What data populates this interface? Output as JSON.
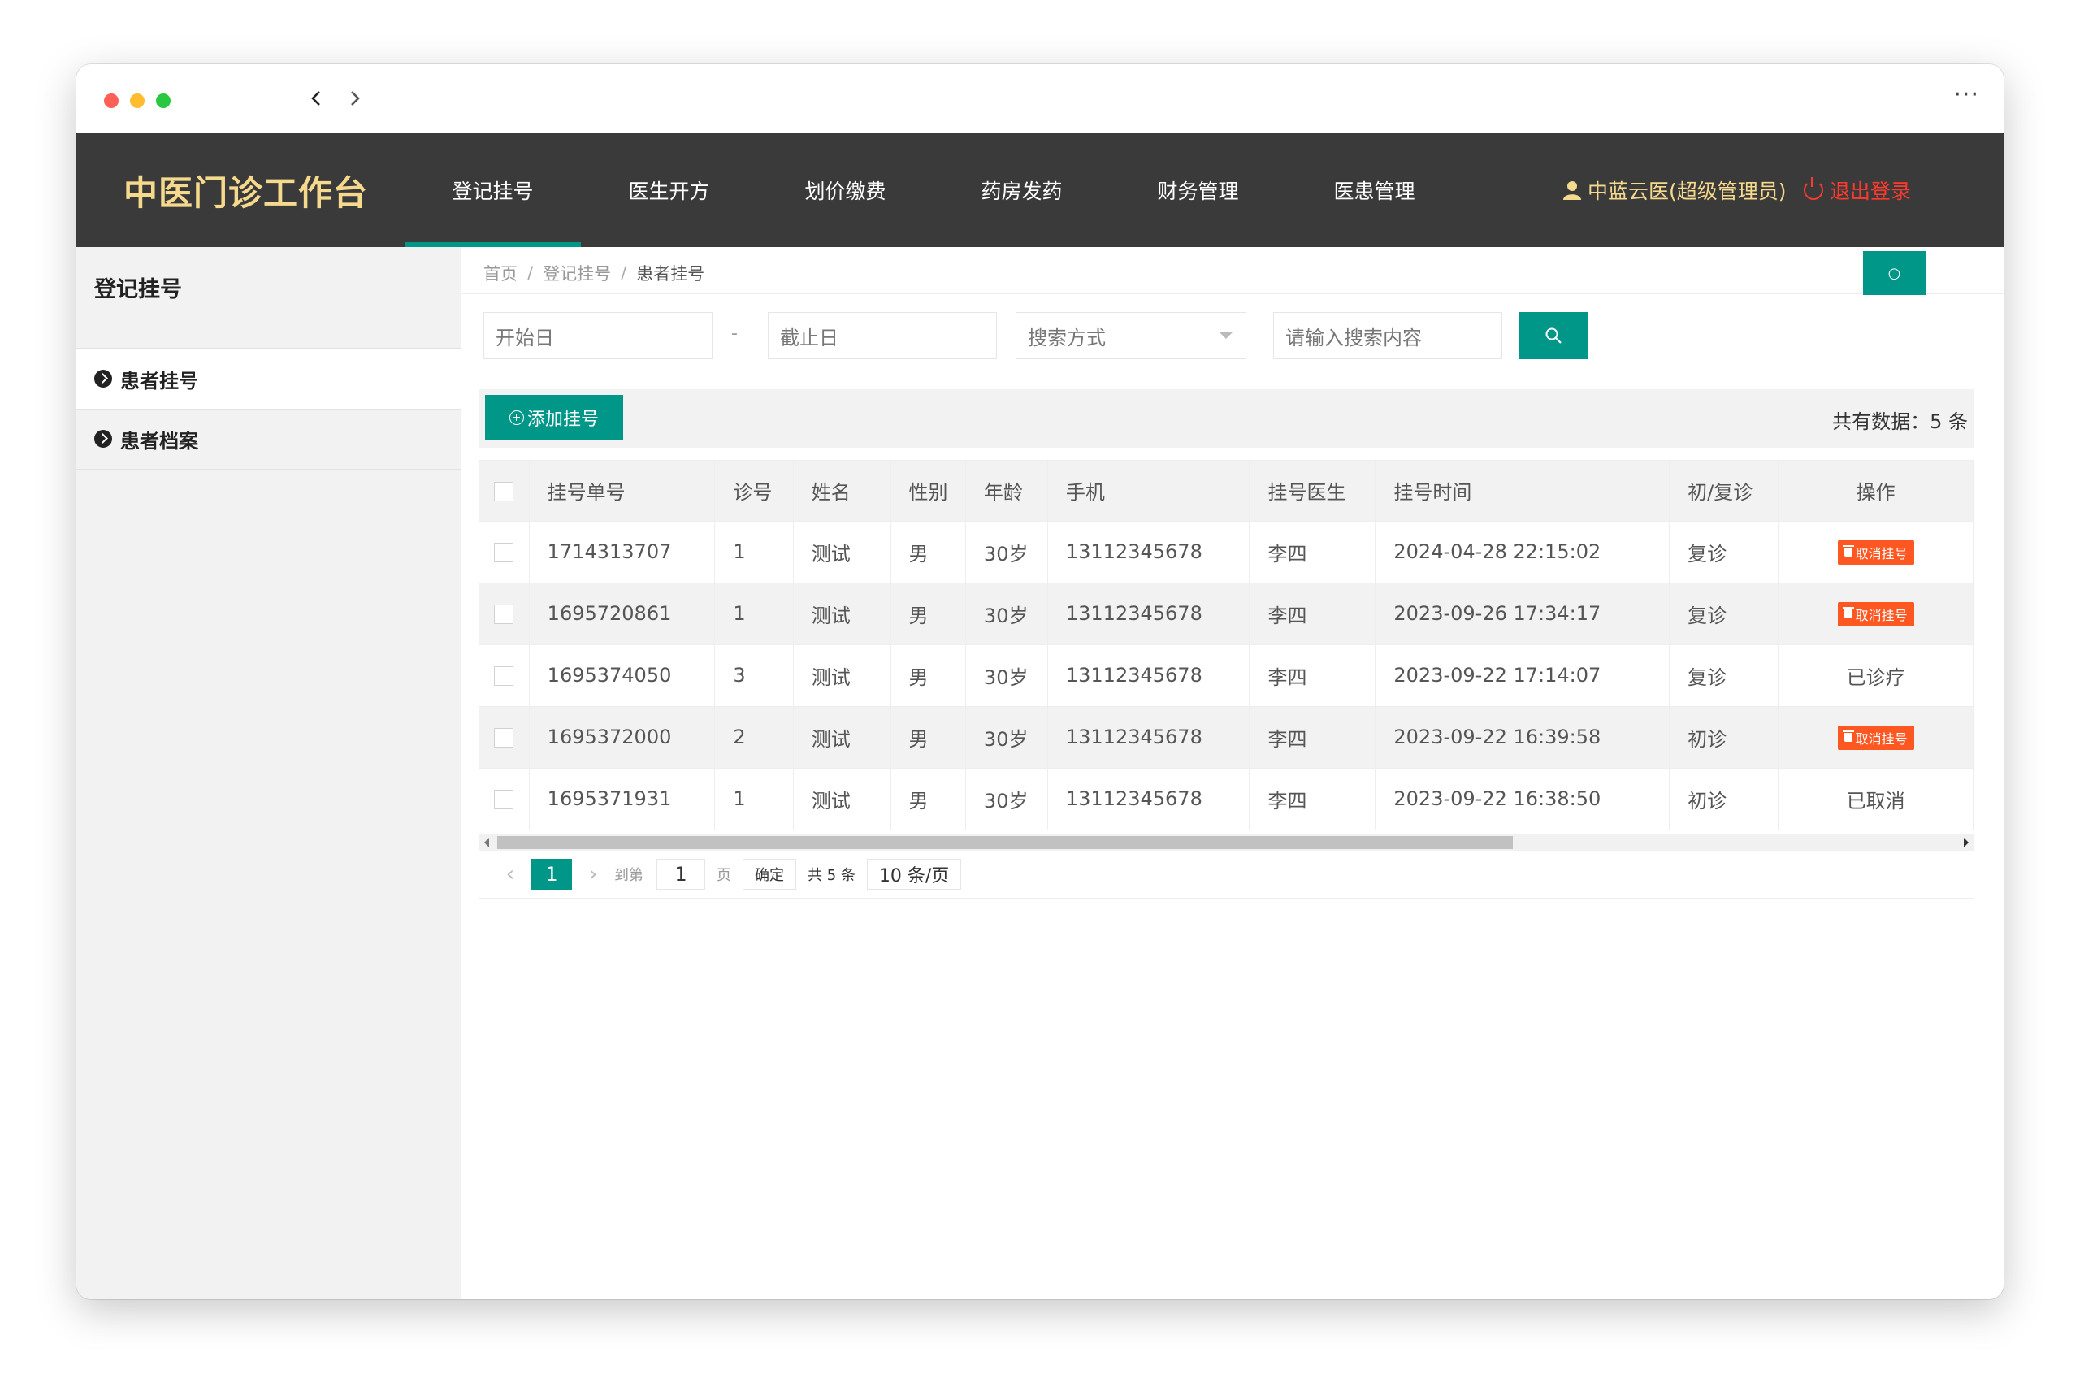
{
  "browser": {
    "back_icon": "chevron-left-icon",
    "forward_icon": "chevron-right-icon",
    "more_label": "···"
  },
  "header": {
    "brand": "中医门诊工作台",
    "menu": [
      {
        "label": "登记挂号",
        "active": true
      },
      {
        "label": "医生开方",
        "active": false
      },
      {
        "label": "划价缴费",
        "active": false
      },
      {
        "label": "药房发药",
        "active": false
      },
      {
        "label": "财务管理",
        "active": false
      },
      {
        "label": "医患管理",
        "active": false
      }
    ],
    "user": "中蓝云医(超级管理员)",
    "logout": "退出登录",
    "accent_color": "#009688",
    "brand_color": "#f5d98c",
    "logout_color": "#ff3b2f"
  },
  "sidebar": {
    "title": "登记挂号",
    "items": [
      {
        "label": "患者挂号",
        "active": true
      },
      {
        "label": "患者档案",
        "active": false
      }
    ]
  },
  "breadcrumb": [
    "首页",
    "登记挂号",
    "患者挂号"
  ],
  "refresh_label": "○",
  "search": {
    "start_placeholder": "开始日",
    "dash": "-",
    "end_placeholder": "截止日",
    "method_placeholder": "搜索方式",
    "keyword_placeholder": "请输入搜索内容"
  },
  "toolbar": {
    "add_label": "添加挂号",
    "total_label": "共有数据：5 条"
  },
  "table": {
    "headers": [
      "挂号单号",
      "诊号",
      "姓名",
      "性别",
      "年龄",
      "手机",
      "挂号医生",
      "挂号时间",
      "初/复诊",
      "操作"
    ],
    "rows": [
      {
        "id": "1714313707",
        "no": "1",
        "name": "测试",
        "sex": "男",
        "age": "30岁",
        "phone": "13112345678",
        "doctor": "李四",
        "time": "2024-04-28 22:15:02",
        "visit": "复诊",
        "action": "取消挂号",
        "action_type": "button"
      },
      {
        "id": "1695720861",
        "no": "1",
        "name": "测试",
        "sex": "男",
        "age": "30岁",
        "phone": "13112345678",
        "doctor": "李四",
        "time": "2023-09-26 17:34:17",
        "visit": "复诊",
        "action": "取消挂号",
        "action_type": "button"
      },
      {
        "id": "1695374050",
        "no": "3",
        "name": "测试",
        "sex": "男",
        "age": "30岁",
        "phone": "13112345678",
        "doctor": "李四",
        "time": "2023-09-22 17:14:07",
        "visit": "复诊",
        "action": "已诊疗",
        "action_type": "text"
      },
      {
        "id": "1695372000",
        "no": "2",
        "name": "测试",
        "sex": "男",
        "age": "30岁",
        "phone": "13112345678",
        "doctor": "李四",
        "time": "2023-09-22 16:39:58",
        "visit": "初诊",
        "action": "取消挂号",
        "action_type": "button"
      },
      {
        "id": "1695371931",
        "no": "1",
        "name": "测试",
        "sex": "男",
        "age": "30岁",
        "phone": "13112345678",
        "doctor": "李四",
        "time": "2023-09-22 16:38:50",
        "visit": "初诊",
        "action": "已取消",
        "action_type": "text"
      }
    ]
  },
  "pager": {
    "prev": "‹",
    "current": "1",
    "next": "›",
    "goto_label": "到第",
    "goto_value": "1",
    "page_unit": "页",
    "ok_label": "确定",
    "count_label": "共 5 条",
    "size_label": "10 条/页"
  }
}
